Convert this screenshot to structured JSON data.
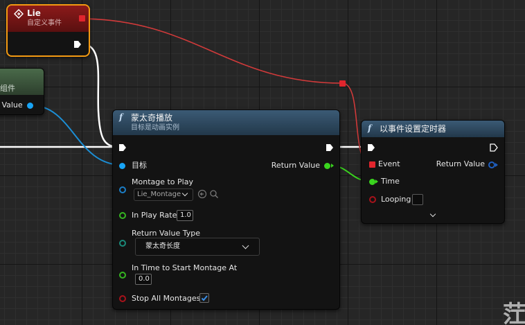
{
  "event_node": {
    "title": "Lie",
    "subtitle": "自定义事件"
  },
  "left_node": {
    "subtitle": "体组件",
    "pin_label": "n Value"
  },
  "montage_node": {
    "title": "蒙太奇播放",
    "subtitle": "目标是动画实例",
    "target_label": "目标",
    "return_value_label": "Return Value",
    "montage_to_play_label": "Montage to Play",
    "montage_selected": "Lie_Montage",
    "in_play_rate_label": "In Play Rate",
    "in_play_rate_value": "1.0",
    "return_value_type_label": "Return Value Type",
    "return_value_type_selected": "蒙太奇长度",
    "in_time_to_start_label": "In Time to Start Montage At",
    "in_time_to_start_value": "0.0",
    "stop_all_montages_label": "Stop All Montages",
    "stop_all_montages_checked": true
  },
  "timer_node": {
    "title": "以事件设置定时器",
    "event_label": "Event",
    "return_value_label": "Return Value",
    "time_label": "Time",
    "looping_label": "Looping",
    "looping_checked": false
  },
  "watermark": "茳",
  "colors": {
    "event_header": "#7a1616",
    "function_header": "#2f4a61",
    "left_node_header": "#3e5a3e",
    "selection_outline": "#f39a12",
    "exec_wire": "#ffffff",
    "object_wire": "#1c8fd6",
    "float_wire": "#3ad51e",
    "delegate_wire": "#d13a3a"
  },
  "icons": {
    "event": "diamond-event-icon",
    "function": "function-f-icon",
    "exec": "exec-arrow-icon",
    "expand": "chevron-down-icon",
    "browse": "arrow-left-circle-icon",
    "search": "search-icon",
    "check": "check-icon"
  }
}
